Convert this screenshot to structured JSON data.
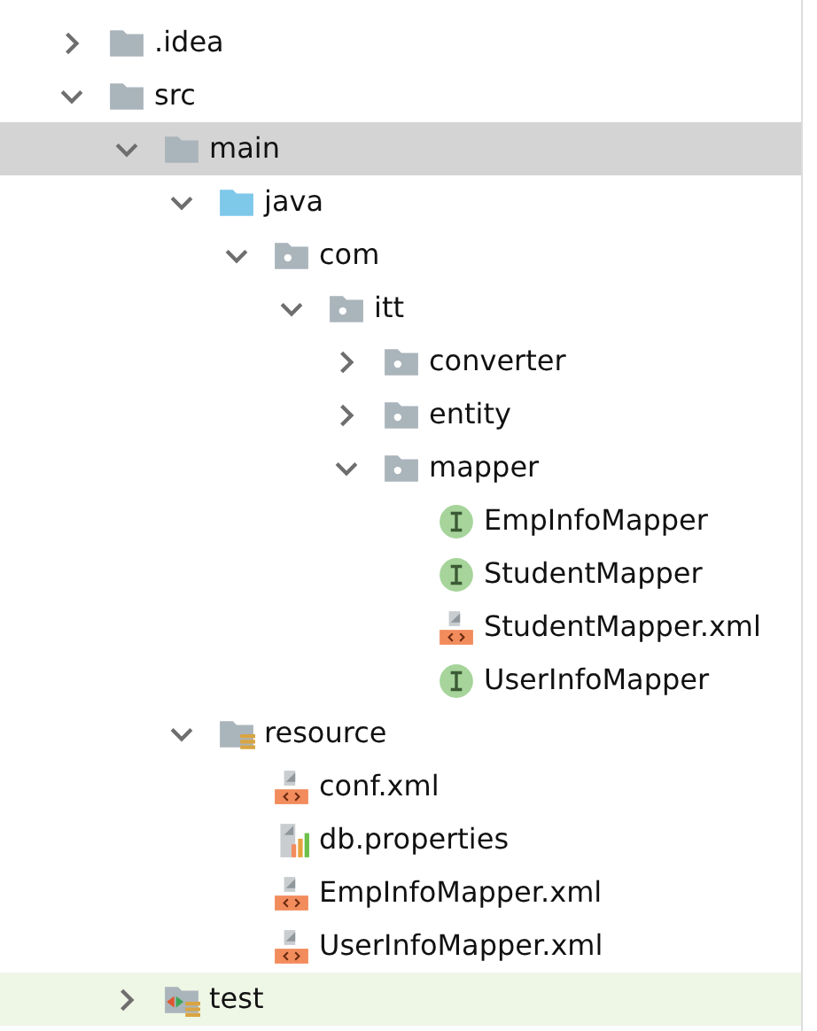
{
  "tree": [
    {
      "label": ".idea",
      "kind": "folder",
      "expanded": false,
      "selected": false,
      "highlighted": false
    },
    {
      "label": "src",
      "kind": "folder",
      "expanded": true,
      "selected": false,
      "highlighted": false,
      "children": [
        {
          "label": "main",
          "kind": "folder",
          "expanded": true,
          "selected": true,
          "highlighted": false,
          "children": [
            {
              "label": "java",
              "kind": "source-folder",
              "expanded": true,
              "selected": false,
              "highlighted": false,
              "children": [
                {
                  "label": "com",
                  "kind": "package",
                  "expanded": true,
                  "selected": false,
                  "highlighted": false,
                  "children": [
                    {
                      "label": "itt",
                      "kind": "package",
                      "expanded": true,
                      "selected": false,
                      "highlighted": false,
                      "children": [
                        {
                          "label": "converter",
                          "kind": "package",
                          "expanded": false,
                          "selected": false,
                          "highlighted": false
                        },
                        {
                          "label": "entity",
                          "kind": "package",
                          "expanded": false,
                          "selected": false,
                          "highlighted": false
                        },
                        {
                          "label": "mapper",
                          "kind": "package",
                          "expanded": true,
                          "selected": false,
                          "highlighted": false,
                          "children": [
                            {
                              "label": "EmpInfoMapper",
                              "kind": "interface",
                              "selected": false,
                              "highlighted": false
                            },
                            {
                              "label": "StudentMapper",
                              "kind": "interface",
                              "selected": false,
                              "highlighted": false
                            },
                            {
                              "label": "StudentMapper.xml",
                              "kind": "xml",
                              "selected": false,
                              "highlighted": false
                            },
                            {
                              "label": "UserInfoMapper",
                              "kind": "interface",
                              "selected": false,
                              "highlighted": false
                            }
                          ]
                        }
                      ]
                    }
                  ]
                }
              ]
            },
            {
              "label": "resource",
              "kind": "resource-folder",
              "expanded": true,
              "selected": false,
              "highlighted": false,
              "children": [
                {
                  "label": "conf.xml",
                  "kind": "xml",
                  "selected": false,
                  "highlighted": false
                },
                {
                  "label": "db.properties",
                  "kind": "properties",
                  "selected": false,
                  "highlighted": false
                },
                {
                  "label": "EmpInfoMapper.xml",
                  "kind": "xml",
                  "selected": false,
                  "highlighted": false
                },
                {
                  "label": "UserInfoMapper.xml",
                  "kind": "xml",
                  "selected": false,
                  "highlighted": false
                }
              ]
            }
          ]
        },
        {
          "label": "test",
          "kind": "test-folder",
          "expanded": false,
          "selected": false,
          "highlighted": true
        }
      ]
    }
  ]
}
